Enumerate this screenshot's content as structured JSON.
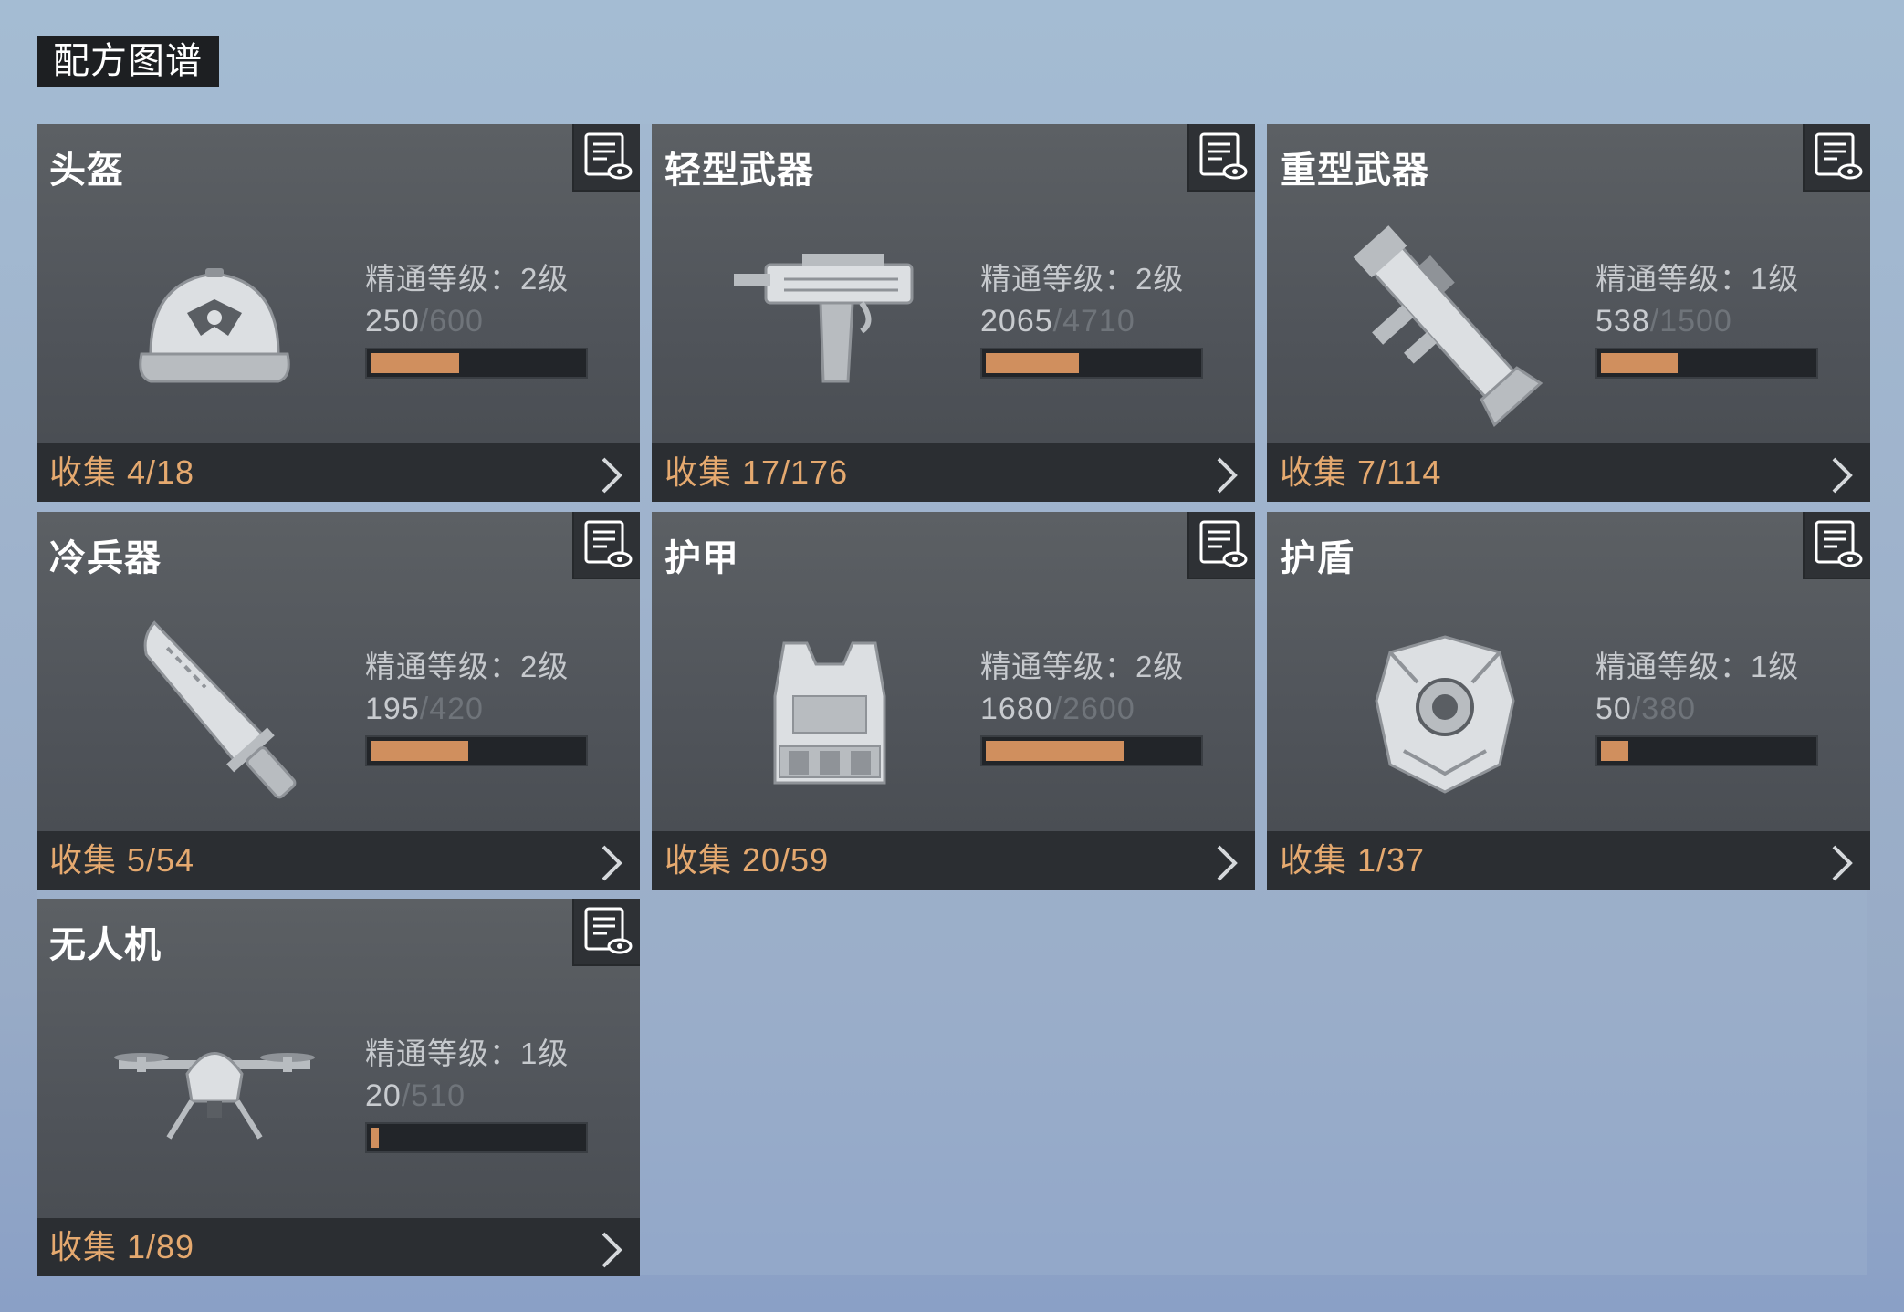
{
  "page_title": "配方图谱",
  "labels": {
    "mastery_prefix": "精通等级：",
    "collect_prefix": "收集 "
  },
  "colors": {
    "accent": "#e5a96f",
    "progress_fill": "#d08f5e",
    "card_bg": "#54585d",
    "footer_bg": "#2b2e32"
  },
  "cards": [
    {
      "title": "头盔",
      "icon": "helmet-icon",
      "mastery": "2级",
      "xp": "250",
      "xp_max": "600",
      "progress": 0.42,
      "collected": "4/18"
    },
    {
      "title": "轻型武器",
      "icon": "submachine-gun-icon",
      "mastery": "2级",
      "xp": "2065",
      "xp_max": "4710",
      "progress": 0.44,
      "collected": "17/176"
    },
    {
      "title": "重型武器",
      "icon": "rocket-launcher-icon",
      "mastery": "1级",
      "xp": "538",
      "xp_max": "1500",
      "progress": 0.36,
      "collected": "7/114"
    },
    {
      "title": "冷兵器",
      "icon": "blade-icon",
      "mastery": "2级",
      "xp": "195",
      "xp_max": "420",
      "progress": 0.46,
      "collected": "5/54"
    },
    {
      "title": "护甲",
      "icon": "body-armor-icon",
      "mastery": "2级",
      "xp": "1680",
      "xp_max": "2600",
      "progress": 0.65,
      "collected": "20/59"
    },
    {
      "title": "护盾",
      "icon": "shield-icon",
      "mastery": "1级",
      "xp": "50",
      "xp_max": "380",
      "progress": 0.13,
      "collected": "1/37"
    },
    {
      "title": "无人机",
      "icon": "drone-icon",
      "mastery": "1级",
      "xp": "20",
      "xp_max": "510",
      "progress": 0.04,
      "collected": "1/89"
    }
  ]
}
